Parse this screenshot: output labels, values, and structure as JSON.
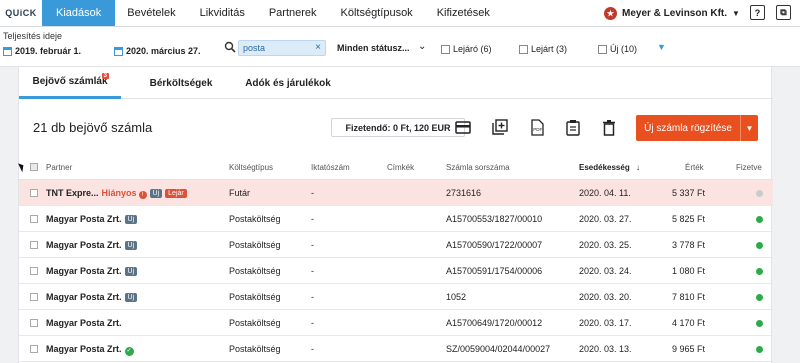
{
  "logo": "QUiCK",
  "nav": {
    "tabs": [
      "Kiadások",
      "Bevételek",
      "Likviditás",
      "Partnerek",
      "Költségtípusok",
      "Kifizetések"
    ],
    "company": "Meyer & Levinson Kft.",
    "help_icon": "?",
    "window_icon": "⧉"
  },
  "filters": {
    "label": "Teljesítés ideje",
    "date_from": "2019. február 1.",
    "date_to": "2020. március 27.",
    "search_value": "posta",
    "status": "Minden státusz...",
    "checkboxes": [
      "Lejáró (6)",
      "Lejárt (3)",
      "Új (10)"
    ]
  },
  "subtabs": [
    {
      "label": "Bejövő számlák",
      "count": "3"
    },
    {
      "label": "Bérköltségek"
    },
    {
      "label": "Adók és járulékok"
    }
  ],
  "toolbar": {
    "title": "21 db bejövő számla",
    "balance": "Fizetendő: 0 Ft, 120 EUR",
    "new_button": "Új számla rögzítése"
  },
  "columns": {
    "partner": "Partner",
    "cost_type": "Költségtípus",
    "file_no": "Iktatószám",
    "labels": "Címkék",
    "invoice_no": "Számla sorszáma",
    "due": "Esedékesség",
    "due_sort": "↓",
    "value": "Érték",
    "paid": "Fizetve"
  },
  "rows": [
    {
      "partner": "TNT Expre...",
      "missing": "Hiányos",
      "badge1": "Új",
      "badge2": "Lejár",
      "cost_type": "Futár",
      "file_no": "-",
      "invoice_no": "2731616",
      "due": "2020. 04. 11.",
      "value": "5 337 Ft",
      "paid_color": "#c9cbce"
    },
    {
      "partner": "Magyar Posta Zrt.",
      "badge1": "Új",
      "cost_type": "Postaköltség",
      "file_no": "-",
      "invoice_no": "A15700553/1827/00010",
      "due": "2020. 03. 27.",
      "value": "5 825 Ft",
      "paid_color": "#2eaa4a"
    },
    {
      "partner": "Magyar Posta Zrt.",
      "badge1": "Új",
      "cost_type": "Postaköltség",
      "file_no": "-",
      "invoice_no": "A15700590/1722/00007",
      "due": "2020. 03. 25.",
      "value": "3 778 Ft",
      "paid_color": "#2eaa4a"
    },
    {
      "partner": "Magyar Posta Zrt.",
      "badge1": "Új",
      "cost_type": "Postaköltség",
      "file_no": "-",
      "invoice_no": "A15700591/1754/00006",
      "due": "2020. 03. 24.",
      "value": "1 080 Ft",
      "paid_color": "#2eaa4a"
    },
    {
      "partner": "Magyar Posta Zrt.",
      "badge1": "Új",
      "cost_type": "Postaköltség",
      "file_no": "-",
      "invoice_no": "1052",
      "due": "2020. 03. 20.",
      "value": "7 810 Ft",
      "paid_color": "#2eaa4a"
    },
    {
      "partner": "Magyar Posta Zrt.",
      "cost_type": "Postaköltség",
      "file_no": "-",
      "invoice_no": "A15700649/1720/00012",
      "due": "2020. 03. 17.",
      "value": "4 170 Ft",
      "paid_color": "#2eaa4a"
    },
    {
      "partner": "Magyar Posta Zrt.",
      "cost_type": "Postaköltség",
      "file_no": "-",
      "invoice_no": "SZ/0059004/02044/00027",
      "due": "2020. 03. 13.",
      "value": "9 965 Ft",
      "paid_color": "#2eaa4a"
    }
  ]
}
